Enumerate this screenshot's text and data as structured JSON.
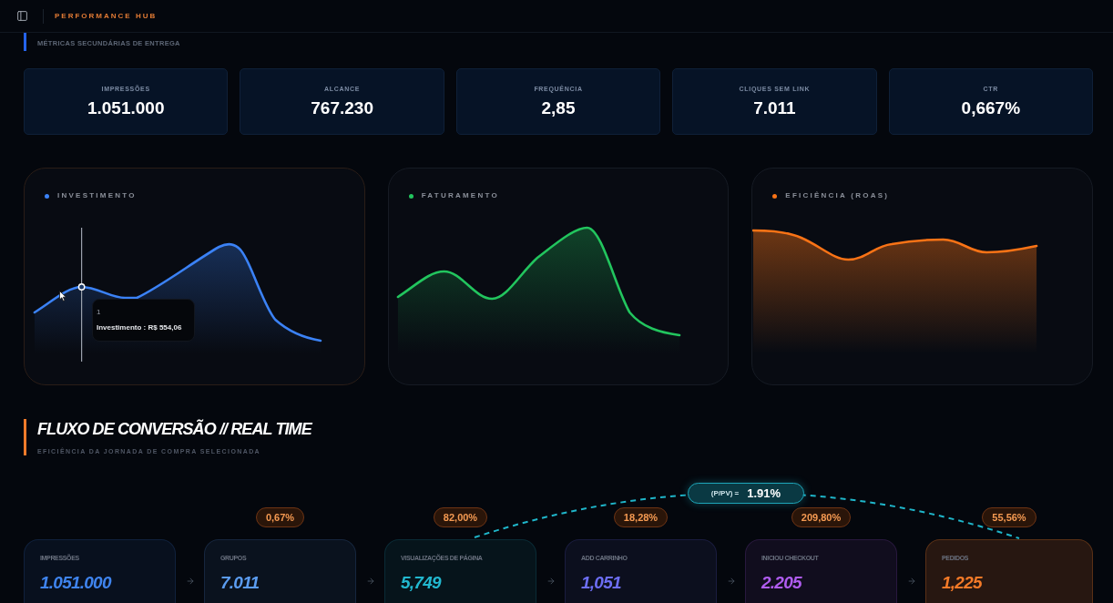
{
  "header": {
    "title": "PERFORMANCE HUB"
  },
  "delivery_section": {
    "subtitle": "MÉTRICAS SECUNDÁRIAS DE ENTREGA",
    "kpis": [
      {
        "label": "IMPRESSÕES",
        "value": "1.051.000"
      },
      {
        "label": "ALCANCE",
        "value": "767.230"
      },
      {
        "label": "FREQUÊNCIA",
        "value": "2,85"
      },
      {
        "label": "CLIQUES SEM LINK",
        "value": "7.011"
      },
      {
        "label": "CTR",
        "value": "0,667%"
      }
    ]
  },
  "charts": [
    {
      "title": "INVESTIMENTO",
      "color": "#3b82f6",
      "tooltip": {
        "label": "1",
        "text": "Investimento : R$ 554,06"
      }
    },
    {
      "title": "FATURAMENTO",
      "color": "#22c55e"
    },
    {
      "title": "EFICIÊNCIA (ROAS)",
      "color": "#f97316"
    }
  ],
  "funnel_section": {
    "title": "FLUXO DE CONVERSÃO // REAL TIME",
    "subtitle": "EFICIÊNCIA DA JORNADA DE COMPRA SELECIONADA",
    "ratio": {
      "label": "(P/PV) =",
      "value": "1.91%"
    },
    "steps": [
      {
        "kind": "stage",
        "label": "IMPRESSÕES",
        "value": "1.051.000",
        "color": "#3f84ee"
      },
      {
        "kind": "stage",
        "label": "GRUPOS",
        "value": "7.011",
        "color": "#5b9cf0",
        "rate": "0,67%"
      },
      {
        "kind": "stage",
        "label": "VISUALIZAÇÕES DE PÁGINA",
        "value": "5,749",
        "color": "#22b8cf",
        "rate": "82,00%"
      },
      {
        "kind": "stage",
        "label": "ADD CARRINHO",
        "value": "1,051",
        "color": "#6d6ef5",
        "rate": "18,28%"
      },
      {
        "kind": "stage",
        "label": "INICIOU CHECKOUT",
        "value": "2.205",
        "color": "#b05cf0",
        "rate": "209,80%"
      },
      {
        "kind": "result",
        "label": "PEDIDOS",
        "value": "1,225",
        "color": "#f47a28",
        "rate": "55,56%"
      }
    ]
  }
}
